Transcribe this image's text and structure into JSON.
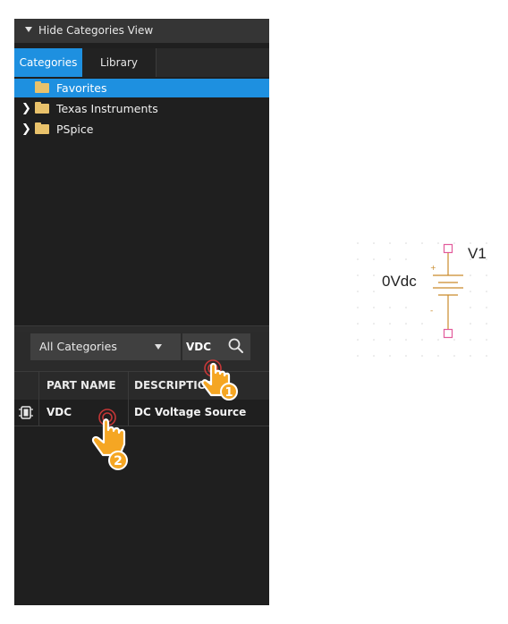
{
  "panel": {
    "hide_categories_label": "Hide Categories View",
    "tabs": [
      {
        "label": "Categories",
        "active": true
      },
      {
        "label": "Library",
        "active": false
      }
    ],
    "tree": [
      {
        "label": "Favorites",
        "expandable": false,
        "selected": true,
        "icon": "folder-icon"
      },
      {
        "label": "Texas Instruments",
        "expandable": true,
        "selected": false,
        "icon": "folder-icon"
      },
      {
        "label": "PSpice",
        "expandable": true,
        "selected": false,
        "icon": "folder-icon"
      }
    ],
    "category_select": {
      "value": "All Categories"
    },
    "search": {
      "value": "VDC",
      "icon": "search-icon"
    },
    "table": {
      "headers": [
        "",
        "PART NAME",
        "DESCRIPTION"
      ],
      "rows": [
        {
          "icon": "part-icon",
          "part_name": "VDC",
          "description": "DC Voltage Source"
        }
      ]
    }
  },
  "annotations": [
    {
      "number": "1"
    },
    {
      "number": "2"
    }
  ],
  "schematic": {
    "part_name": "V1",
    "part_value": "0Vdc",
    "plus_sign": "+",
    "minus_sign": "-"
  },
  "colors": {
    "panel_bg": "#1f1f1f",
    "selection": "#1e90e0",
    "accent_orange": "#f5a623",
    "pin_color": "#e25b9b",
    "symbol_color": "#c98a2a"
  }
}
